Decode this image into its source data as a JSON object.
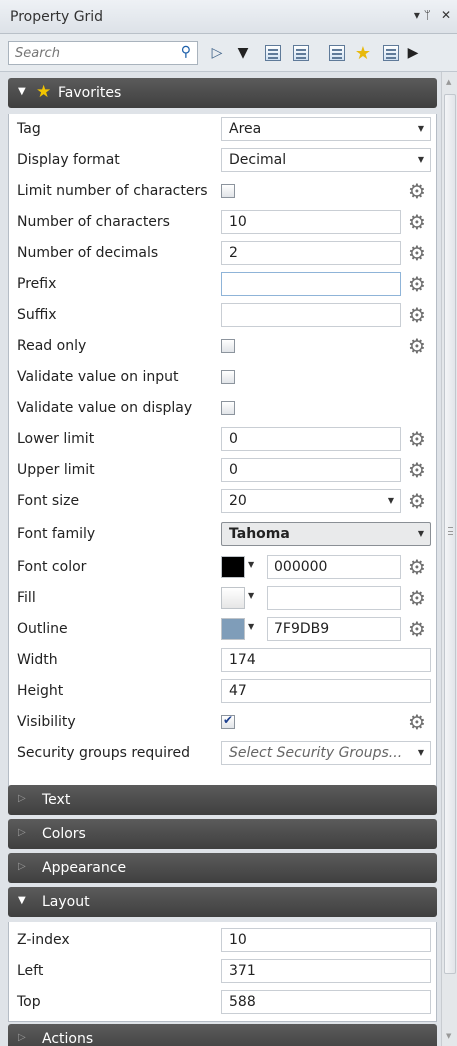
{
  "window": {
    "title": "Property Grid",
    "pin": "▾ ᛘ",
    "close": "✕"
  },
  "toolbar": {
    "search_placeholder": "Search"
  },
  "sections": {
    "favorites": "Favorites",
    "text": "Text",
    "colors": "Colors",
    "appearance": "Appearance",
    "layout": "Layout",
    "actions": "Actions"
  },
  "favorites": {
    "tag": {
      "label": "Tag",
      "value": "Area"
    },
    "display_format": {
      "label": "Display format",
      "value": "Decimal"
    },
    "limit_chars": {
      "label": "Limit number of characters",
      "checked": false
    },
    "num_chars": {
      "label": "Number of characters",
      "value": "10"
    },
    "num_decimals": {
      "label": "Number of decimals",
      "value": "2"
    },
    "prefix": {
      "label": "Prefix",
      "value": ""
    },
    "suffix": {
      "label": "Suffix",
      "value": ""
    },
    "read_only": {
      "label": "Read only",
      "checked": false
    },
    "validate_input": {
      "label": "Validate value on input",
      "checked": false
    },
    "validate_display": {
      "label": "Validate value on display",
      "checked": false
    },
    "lower_limit": {
      "label": "Lower limit",
      "value": "0"
    },
    "upper_limit": {
      "label": "Upper limit",
      "value": "0"
    },
    "font_size": {
      "label": "Font size",
      "value": "20"
    },
    "font_family": {
      "label": "Font family",
      "value": "Tahoma"
    },
    "font_color": {
      "label": "Font color",
      "swatch": "#000000",
      "value": "000000"
    },
    "fill": {
      "label": "Fill",
      "swatch": "#eeeeee",
      "value": ""
    },
    "outline": {
      "label": "Outline",
      "swatch": "#7F9DB9",
      "value": "7F9DB9"
    },
    "width": {
      "label": "Width",
      "value": "174"
    },
    "height": {
      "label": "Height",
      "value": "47"
    },
    "visibility": {
      "label": "Visibility",
      "checked": true
    },
    "security": {
      "label": "Security groups required",
      "value": "Select Security Groups..."
    }
  },
  "layout": {
    "z_index": {
      "label": "Z-index",
      "value": "10"
    },
    "left": {
      "label": "Left",
      "value": "371"
    },
    "top": {
      "label": "Top",
      "value": "588"
    }
  }
}
